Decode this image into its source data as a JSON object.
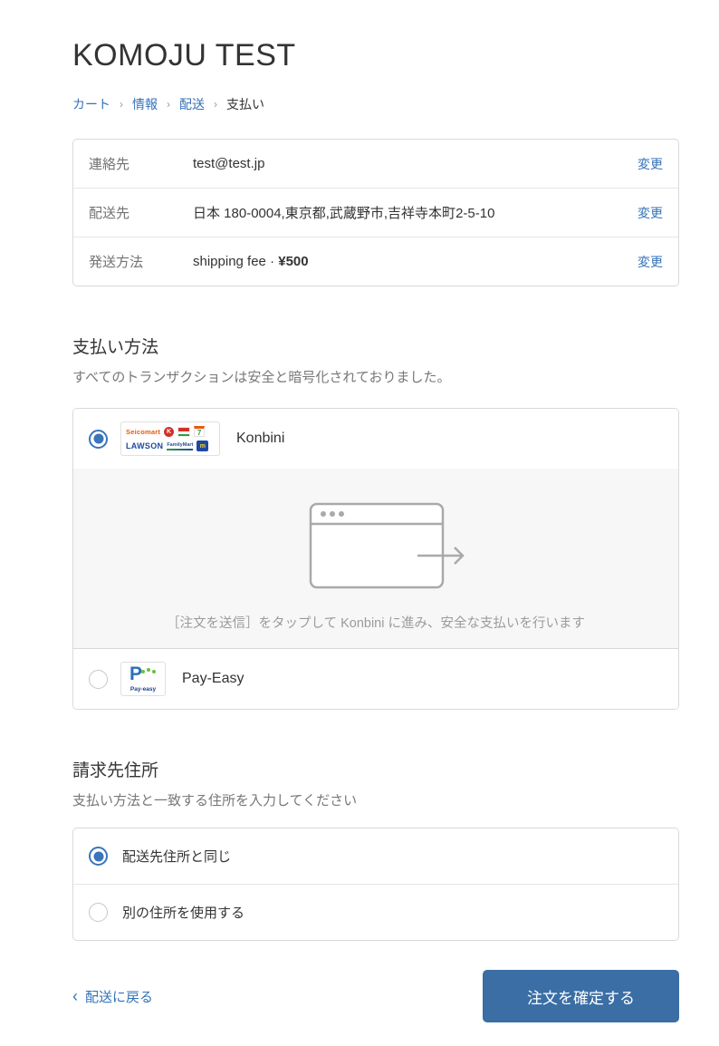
{
  "page": {
    "title": "KOMOJU TEST"
  },
  "breadcrumb": {
    "separator": "›",
    "items": [
      {
        "label": "カート"
      },
      {
        "label": "情報"
      },
      {
        "label": "配送"
      },
      {
        "label": "支払い"
      }
    ]
  },
  "summary": {
    "rows": [
      {
        "label": "連絡先",
        "value": "test@test.jp",
        "value_bold": "",
        "action": "変更"
      },
      {
        "label": "配送先",
        "value": "日本 180-0004,東京都,武蔵野市,吉祥寺本町2-5-10",
        "value_bold": "",
        "action": "変更"
      },
      {
        "label": "発送方法",
        "value": "shipping fee · ",
        "value_bold": "¥500",
        "action": "変更"
      }
    ]
  },
  "payment": {
    "heading": "支払い方法",
    "subheading": "すべてのトランザクションは安全と暗号化されておりました。",
    "methods": [
      {
        "label": "Konbini",
        "selected": true
      },
      {
        "label": "Pay-Easy",
        "selected": false
      }
    ],
    "konbini_note": "［注文を送信］をタップして Konbini に進み、安全な支払いを行います",
    "logos": {
      "seicomart": "Seicomart",
      "lawson": "LAWSON",
      "familymart": "FamilyMart",
      "circlek": "K",
      "seven": "7",
      "ministop": "m",
      "payeasy_p": "P",
      "payeasy_text": "Pay-easy"
    }
  },
  "billing": {
    "heading": "請求先住所",
    "subheading": "支払い方法と一致する住所を入力してください",
    "options": [
      {
        "label": "配送先住所と同じ",
        "selected": true
      },
      {
        "label": "別の住所を使用する",
        "selected": false
      }
    ]
  },
  "footer": {
    "back_icon": "‹",
    "back_label": "配送に戻る",
    "submit_label": "注文を確定する"
  },
  "colors": {
    "link_blue": "#3573b8",
    "button_blue": "#3a6ea5",
    "radio_blue": "#3a74ba",
    "panel_gray": "#f7f7f7",
    "border_gray": "#d9d9d9"
  }
}
